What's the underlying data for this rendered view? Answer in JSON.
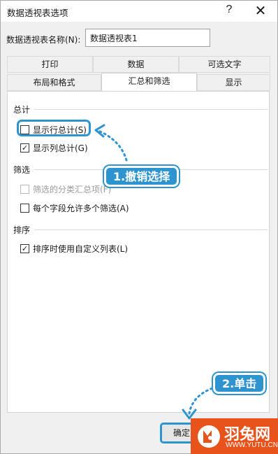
{
  "window": {
    "title": "数据透视表选项",
    "help": "?",
    "close": "✕"
  },
  "name_field": {
    "label": "数据透视表名称(N):",
    "value": "数据透视表1"
  },
  "tabs_row1": [
    {
      "label": "打印"
    },
    {
      "label": "数据"
    },
    {
      "label": "可选文字"
    }
  ],
  "tabs_row2": [
    {
      "label": "布局和格式"
    },
    {
      "label": "汇总和筛选",
      "active": true
    },
    {
      "label": "显示"
    }
  ],
  "sections": {
    "totals": {
      "title": "总计",
      "options": [
        {
          "label": "显示行总计(S)",
          "checked": false,
          "mark": ""
        },
        {
          "label": "显示列总计(G)",
          "checked": true,
          "mark": "✓"
        }
      ]
    },
    "filters": {
      "title": "筛选",
      "options": [
        {
          "label": "筛选的分类汇总项(F)",
          "checked": false,
          "disabled": true,
          "mark": ""
        },
        {
          "label": "每个字段允许多个筛选(A)",
          "checked": false,
          "mark": ""
        }
      ]
    },
    "sorting": {
      "title": "排序",
      "options": [
        {
          "label": "排序时使用自定义列表(L)",
          "checked": true,
          "mark": "✓"
        }
      ]
    }
  },
  "annotations": {
    "step1": "1.撤销选择",
    "step2": "2.单击",
    "accent_color": "#2e94d0"
  },
  "buttons": {
    "ok": "确定"
  },
  "watermark": {
    "name": "羽兔网",
    "url": "WWW.YUTU.CN",
    "color": "#e8521b"
  }
}
